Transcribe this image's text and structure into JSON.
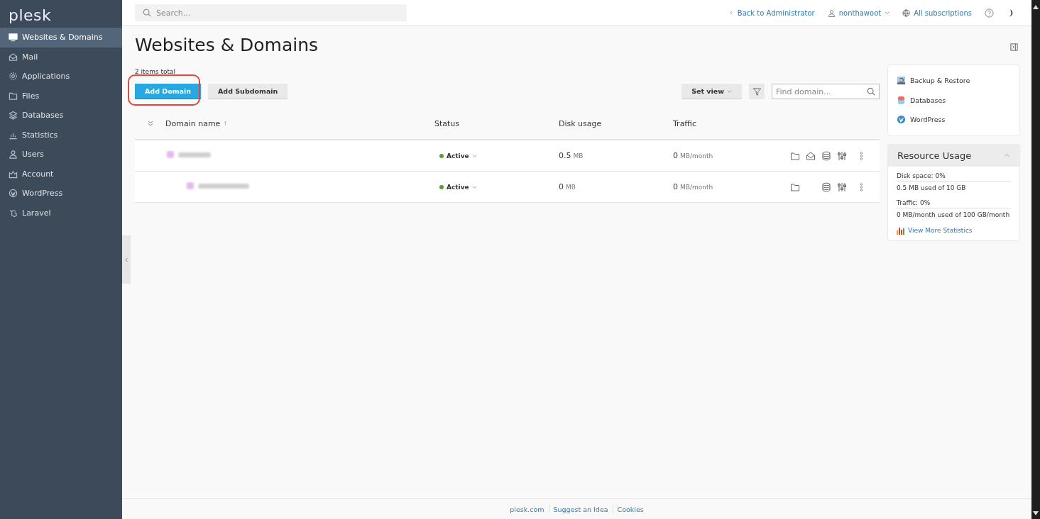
{
  "logo": "plesk",
  "sidebar": {
    "items": [
      {
        "label": "Websites & Domains",
        "selected": true
      },
      {
        "label": "Mail",
        "selected": false
      },
      {
        "label": "Applications",
        "selected": false
      },
      {
        "label": "Files",
        "selected": false
      },
      {
        "label": "Databases",
        "selected": false
      },
      {
        "label": "Statistics",
        "selected": false
      },
      {
        "label": "Users",
        "selected": false
      },
      {
        "label": "Account",
        "selected": false
      },
      {
        "label": "WordPress",
        "selected": false
      },
      {
        "label": "Laravel",
        "selected": false
      }
    ]
  },
  "header": {
    "search": {
      "placeholder": "Search..."
    },
    "back_link": "Back to Administrator",
    "user": "nonthawoot",
    "subscriptions": "All subscriptions"
  },
  "page": {
    "title": "Websites & Domains",
    "items_total": "2 items total",
    "buttons": [
      {
        "label": "Add Domain",
        "primary": true,
        "highlighted": true
      },
      {
        "label": "Add Subdomain",
        "primary": false,
        "highlighted": false
      }
    ],
    "set_view": "Set view",
    "find": {
      "placeholder": "Find domain..."
    },
    "columns": [
      "Domain name",
      "Status",
      "Disk usage",
      "Traffic"
    ],
    "rows": [
      {
        "kind": "domain",
        "status": "Active",
        "disk": "0.5",
        "disk_unit": "MB",
        "traffic": "0",
        "traffic_unit": "MB/month",
        "mail": true
      },
      {
        "kind": "subdomain",
        "status": "Active",
        "disk": "0",
        "disk_unit": "MB",
        "traffic": "0",
        "traffic_unit": "MB/month",
        "mail": false
      }
    ]
  },
  "right": {
    "links": [
      {
        "label": "Backup & Restore"
      },
      {
        "label": "Databases"
      },
      {
        "label": "WordPress"
      }
    ],
    "resource": {
      "title": "Resource Usage",
      "lines": [
        {
          "label": "Disk space: 0%",
          "detail": "0.5 MB used of 10 GB"
        },
        {
          "label": "Traffic: 0%",
          "detail": "0 MB/month used of 100 GB/month"
        }
      ],
      "link": "View More Statistics"
    }
  },
  "footer": [
    "plesk.com",
    "Suggest an Idea",
    "Cookies"
  ]
}
